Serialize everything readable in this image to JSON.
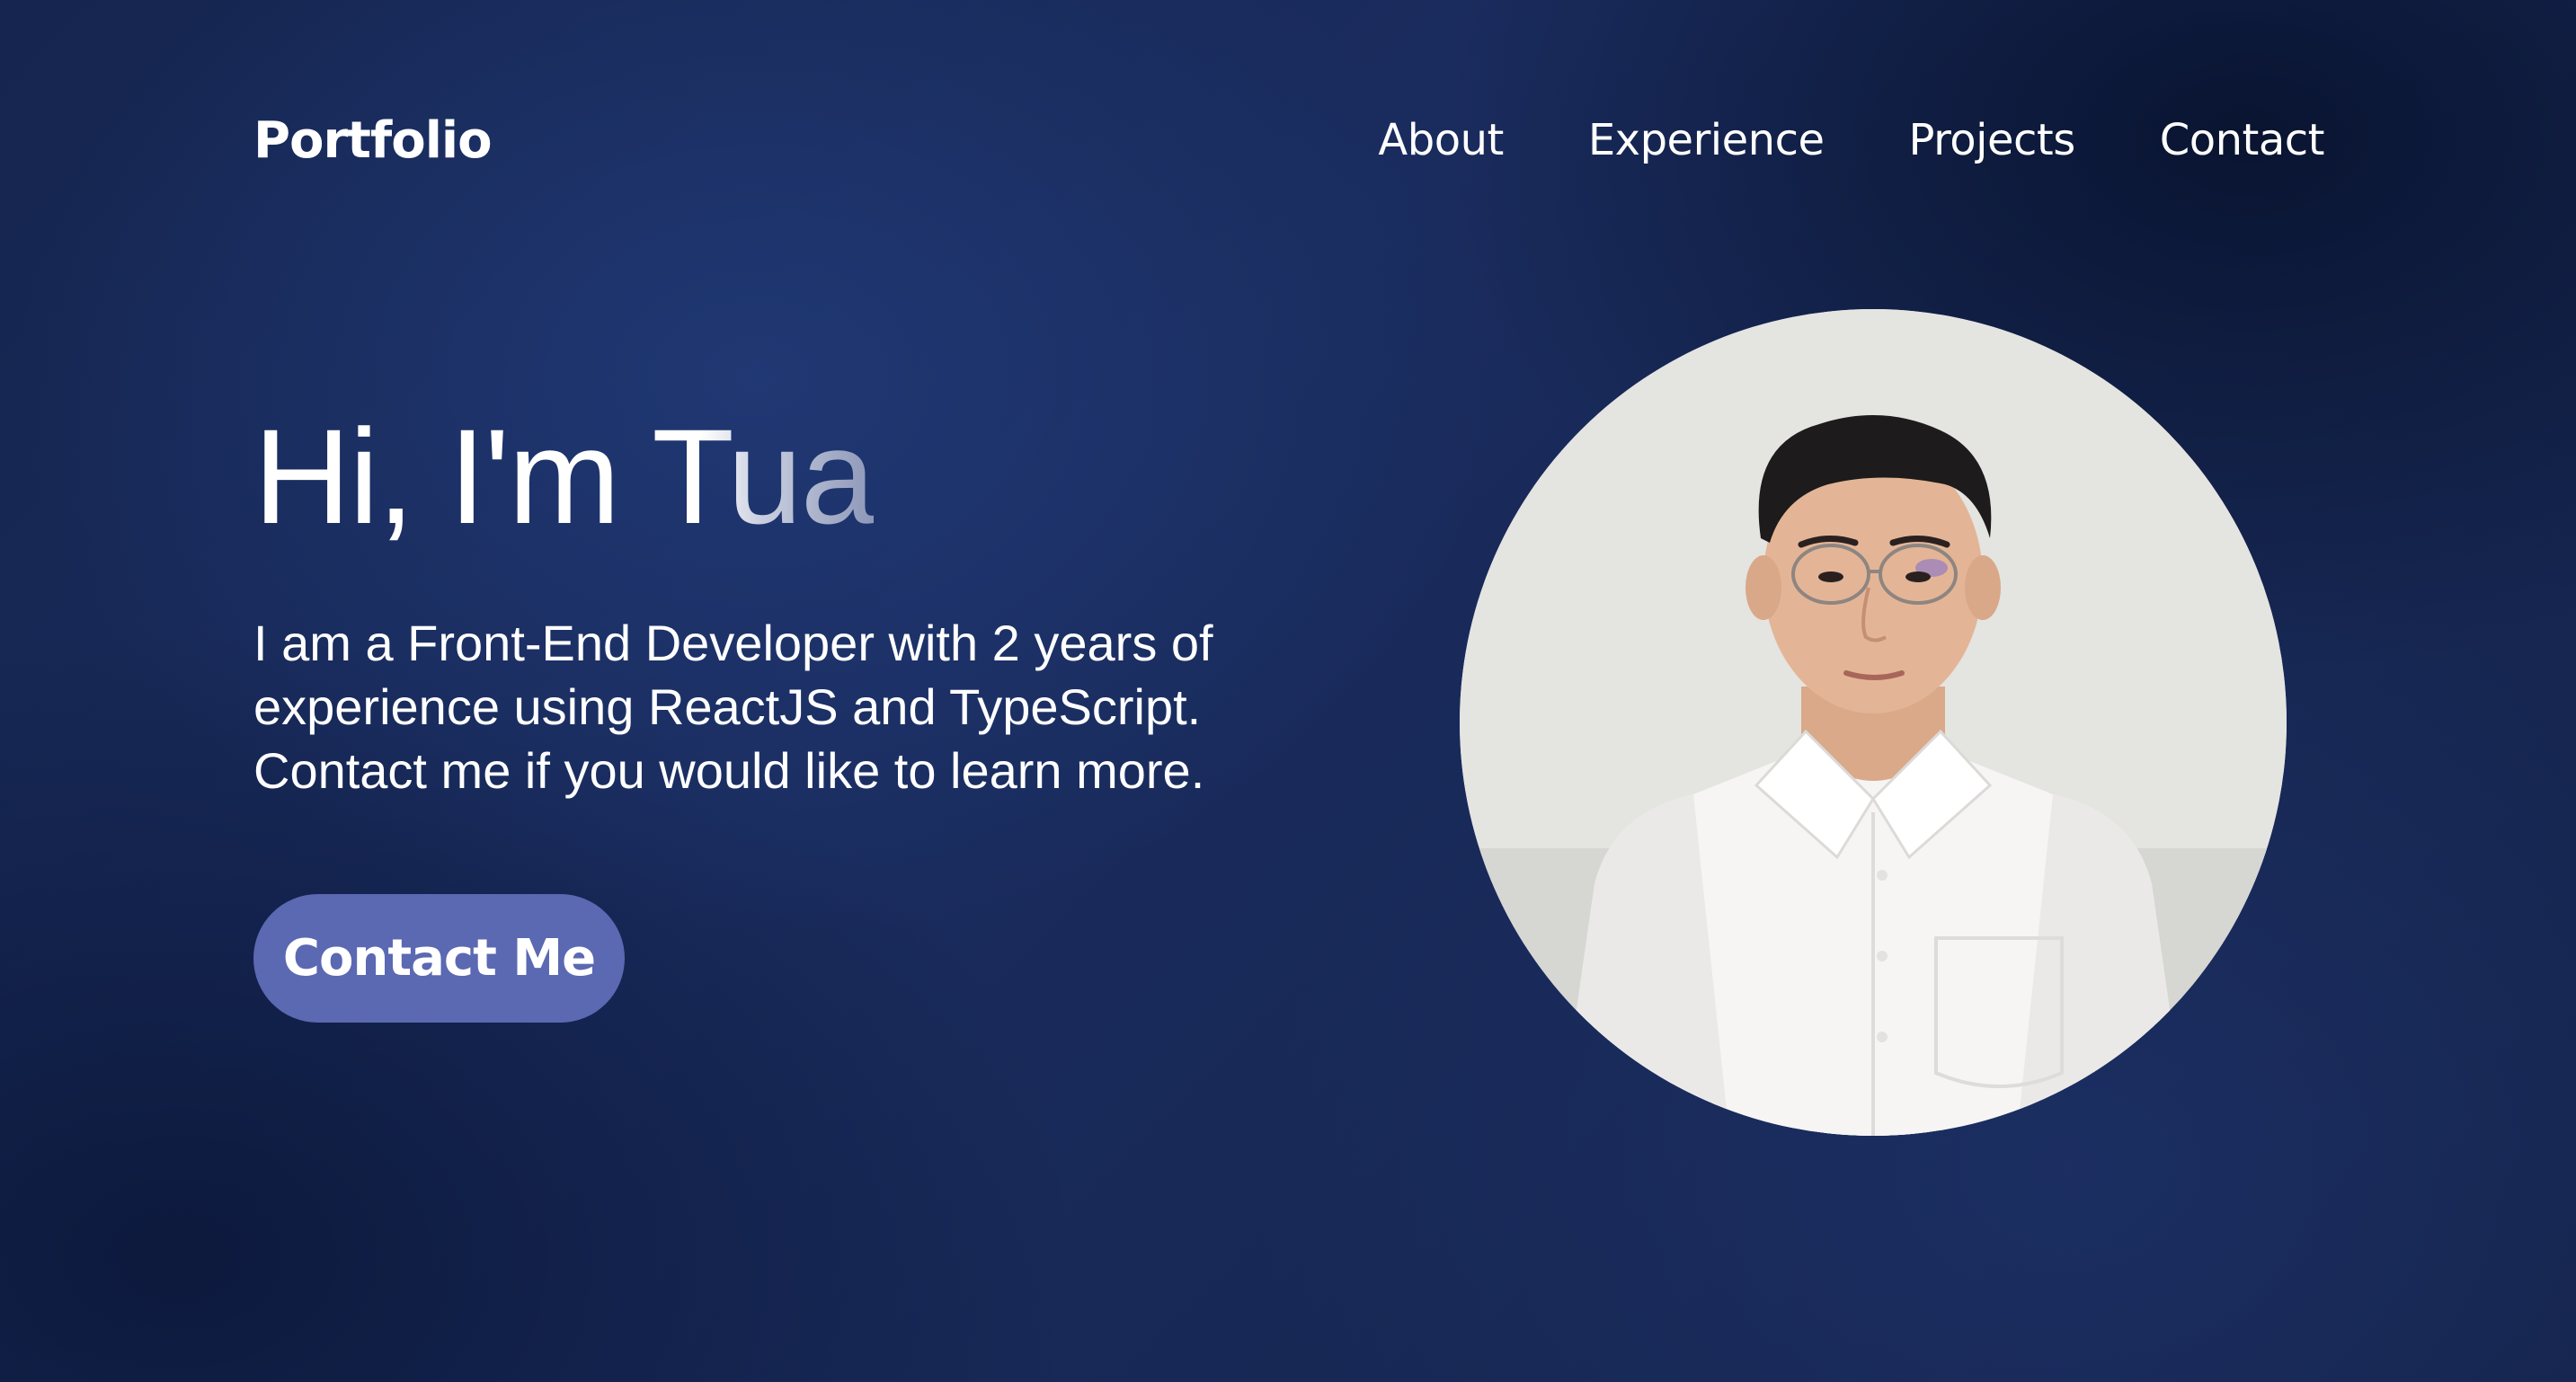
{
  "nav": {
    "logo": "Portfolio",
    "links": [
      {
        "label": "About"
      },
      {
        "label": "Experience"
      },
      {
        "label": "Projects"
      },
      {
        "label": "Contact"
      }
    ]
  },
  "hero": {
    "title": "Hi, I'm Tua",
    "description": "I am a Front-End Developer with 2 years of experience using ReactJS and TypeScript. Contact me if you would like to learn more.",
    "cta_label": "Contact Me"
  },
  "colors": {
    "background": "#14244e",
    "accent": "#5b68b2",
    "text": "#ffffff"
  }
}
